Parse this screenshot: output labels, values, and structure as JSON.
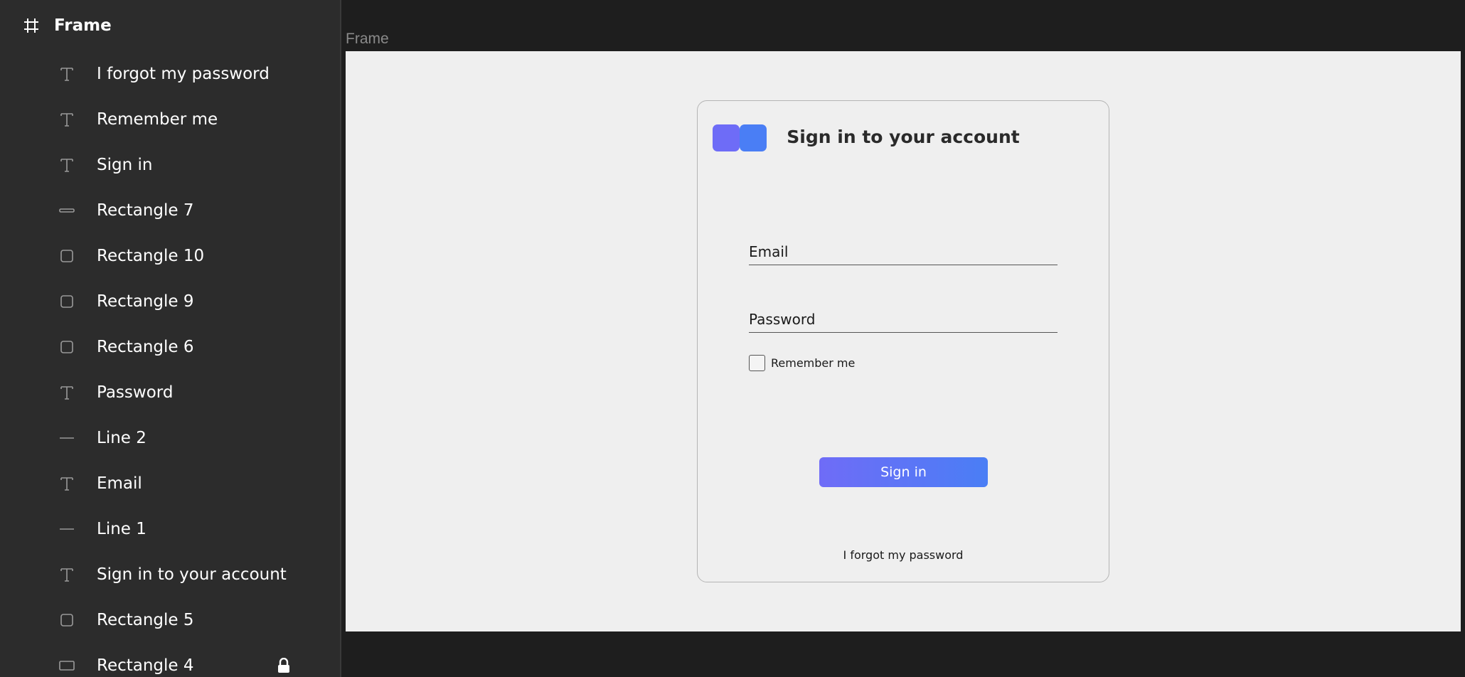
{
  "layers": {
    "frame_name": "Frame",
    "items": [
      {
        "label": "I forgot my password",
        "icon": "text-icon"
      },
      {
        "label": "Remember me",
        "icon": "text-icon"
      },
      {
        "label": "Sign in",
        "icon": "text-icon"
      },
      {
        "label": "Rectangle 7",
        "icon": "thin-rectangle-icon"
      },
      {
        "label": "Rectangle 10",
        "icon": "rectangle-icon"
      },
      {
        "label": "Rectangle 9",
        "icon": "rectangle-icon"
      },
      {
        "label": "Rectangle 6",
        "icon": "rectangle-icon"
      },
      {
        "label": "Password",
        "icon": "text-icon"
      },
      {
        "label": "Line 2",
        "icon": "line-icon"
      },
      {
        "label": "Email",
        "icon": "text-icon"
      },
      {
        "label": "Line 1",
        "icon": "line-icon"
      },
      {
        "label": "Sign in to your account",
        "icon": "text-icon"
      },
      {
        "label": "Rectangle 5",
        "icon": "rectangle-icon"
      },
      {
        "label": "Rectangle 4",
        "icon": "wide-rectangle-icon",
        "locked": true
      }
    ]
  },
  "canvas": {
    "frame_label": "Frame"
  },
  "card": {
    "title": "Sign in to your account",
    "email_label": "Email",
    "password_label": "Password",
    "remember_label": "Remember me",
    "signin_label": "Sign in",
    "forgot_label": "I forgot my password"
  },
  "colors": {
    "logo_left": "#6e6cf7",
    "logo_right": "#4a7ef5",
    "button_gradient_start": "#6f6cf7",
    "button_gradient_end": "#4a7ef5",
    "frame_background": "#efefef",
    "panel_background": "#2c2c2c"
  }
}
